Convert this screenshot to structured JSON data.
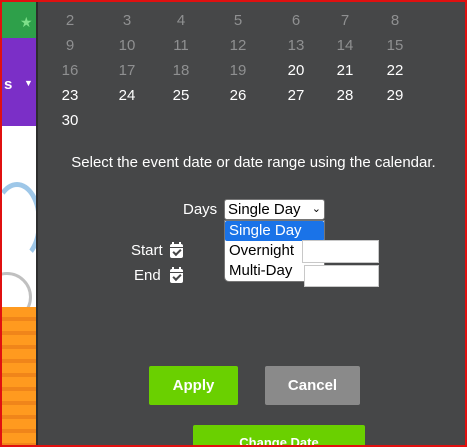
{
  "calendar": {
    "rows": [
      [
        {
          "d": "2",
          "on": false
        },
        {
          "d": "3",
          "on": false
        },
        {
          "d": "4",
          "on": false
        },
        {
          "d": "5",
          "on": false
        },
        {
          "d": "6",
          "on": false
        },
        {
          "d": "7",
          "on": false
        },
        {
          "d": "8",
          "on": false
        }
      ],
      [
        {
          "d": "9",
          "on": false
        },
        {
          "d": "10",
          "on": false
        },
        {
          "d": "11",
          "on": false
        },
        {
          "d": "12",
          "on": false
        },
        {
          "d": "13",
          "on": false
        },
        {
          "d": "14",
          "on": false
        },
        {
          "d": "15",
          "on": false
        }
      ],
      [
        {
          "d": "16",
          "on": false
        },
        {
          "d": "17",
          "on": false
        },
        {
          "d": "18",
          "on": false
        },
        {
          "d": "19",
          "on": false
        },
        {
          "d": "20",
          "on": true
        },
        {
          "d": "21",
          "on": true
        },
        {
          "d": "22",
          "on": true
        }
      ],
      [
        {
          "d": "23",
          "on": true
        },
        {
          "d": "24",
          "on": true
        },
        {
          "d": "25",
          "on": true
        },
        {
          "d": "26",
          "on": true
        },
        {
          "d": "27",
          "on": true
        },
        {
          "d": "28",
          "on": true
        },
        {
          "d": "29",
          "on": true
        }
      ],
      [
        {
          "d": "30",
          "on": true
        }
      ]
    ]
  },
  "instruction": "Select the event date or date range using the calendar.",
  "days": {
    "label": "Days",
    "selected": "Single Day",
    "options": [
      "Single Day",
      "Overnight",
      "Multi-Day"
    ]
  },
  "start": {
    "label": "Start"
  },
  "end": {
    "label": "End"
  },
  "buttons": {
    "apply": "Apply",
    "cancel": "Cancel",
    "change_date": "Change Date"
  },
  "background": {
    "partial_text": "s"
  },
  "colors": {
    "accent_green": "#6ad000",
    "cancel_gray": "#8a8a8a",
    "panel_bg": "#464748",
    "selected_option": "#1a73e8"
  }
}
